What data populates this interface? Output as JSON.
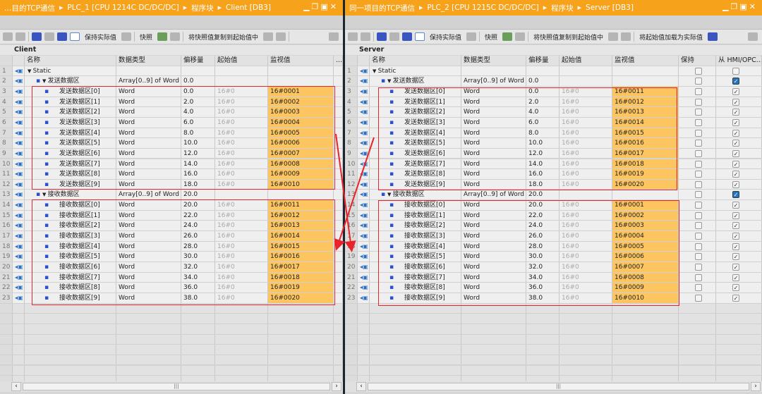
{
  "left": {
    "title": [
      "…目的TCP通信",
      "PLC_1 [CPU 1214C DC/DC/DC]",
      "程序块",
      "Client [DB3]"
    ],
    "toolbar": {
      "keep_actual": "保持实际值",
      "snapshot": "快照",
      "copy_snapshot": "将快照值复制到起始值中"
    },
    "section": "Client",
    "headers": [
      "名称",
      "数据类型",
      "偏移量",
      "起始值",
      "监视值",
      "..."
    ],
    "rows": [
      {
        "n": "1",
        "name": "Static",
        "type": "",
        "off": "",
        "start": "",
        "mon": "",
        "lvl": 0,
        "arrow": true
      },
      {
        "n": "2",
        "name": "发送数据区",
        "type": "Array[0..9] of Word",
        "off": "0.0",
        "start": "",
        "mon": "",
        "lvl": 1,
        "arrow": true
      },
      {
        "n": "3",
        "name": "发送数据区[0]",
        "type": "Word",
        "off": "0.0",
        "start": "16#0",
        "mon": "16#0001",
        "lvl": 2
      },
      {
        "n": "4",
        "name": "发送数据区[1]",
        "type": "Word",
        "off": "2.0",
        "start": "16#0",
        "mon": "16#0002",
        "lvl": 2
      },
      {
        "n": "5",
        "name": "发送数据区[2]",
        "type": "Word",
        "off": "4.0",
        "start": "16#0",
        "mon": "16#0003",
        "lvl": 2
      },
      {
        "n": "6",
        "name": "发送数据区[3]",
        "type": "Word",
        "off": "6.0",
        "start": "16#0",
        "mon": "16#0004",
        "lvl": 2
      },
      {
        "n": "7",
        "name": "发送数据区[4]",
        "type": "Word",
        "off": "8.0",
        "start": "16#0",
        "mon": "16#0005",
        "lvl": 2
      },
      {
        "n": "8",
        "name": "发送数据区[5]",
        "type": "Word",
        "off": "10.0",
        "start": "16#0",
        "mon": "16#0006",
        "lvl": 2
      },
      {
        "n": "9",
        "name": "发送数据区[6]",
        "type": "Word",
        "off": "12.0",
        "start": "16#0",
        "mon": "16#0007",
        "lvl": 2
      },
      {
        "n": "10",
        "name": "发送数据区[7]",
        "type": "Word",
        "off": "14.0",
        "start": "16#0",
        "mon": "16#0008",
        "lvl": 2
      },
      {
        "n": "11",
        "name": "发送数据区[8]",
        "type": "Word",
        "off": "16.0",
        "start": "16#0",
        "mon": "16#0009",
        "lvl": 2
      },
      {
        "n": "12",
        "name": "发送数据区[9]",
        "type": "Word",
        "off": "18.0",
        "start": "16#0",
        "mon": "16#0010",
        "lvl": 2
      },
      {
        "n": "13",
        "name": "接收数据区",
        "type": "Array[0..9] of Word",
        "off": "20.0",
        "start": "",
        "mon": "",
        "lvl": 1,
        "arrow": true
      },
      {
        "n": "14",
        "name": "接收数据区[0]",
        "type": "Word",
        "off": "20.0",
        "start": "16#0",
        "mon": "16#0011",
        "lvl": 2
      },
      {
        "n": "15",
        "name": "接收数据区[1]",
        "type": "Word",
        "off": "22.0",
        "start": "16#0",
        "mon": "16#0012",
        "lvl": 2
      },
      {
        "n": "16",
        "name": "接收数据区[2]",
        "type": "Word",
        "off": "24.0",
        "start": "16#0",
        "mon": "16#0013",
        "lvl": 2
      },
      {
        "n": "17",
        "name": "接收数据区[3]",
        "type": "Word",
        "off": "26.0",
        "start": "16#0",
        "mon": "16#0014",
        "lvl": 2
      },
      {
        "n": "18",
        "name": "接收数据区[4]",
        "type": "Word",
        "off": "28.0",
        "start": "16#0",
        "mon": "16#0015",
        "lvl": 2
      },
      {
        "n": "19",
        "name": "接收数据区[5]",
        "type": "Word",
        "off": "30.0",
        "start": "16#0",
        "mon": "16#0016",
        "lvl": 2
      },
      {
        "n": "20",
        "name": "接收数据区[6]",
        "type": "Word",
        "off": "32.0",
        "start": "16#0",
        "mon": "16#0017",
        "lvl": 2
      },
      {
        "n": "21",
        "name": "接收数据区[7]",
        "type": "Word",
        "off": "34.0",
        "start": "16#0",
        "mon": "16#0018",
        "lvl": 2
      },
      {
        "n": "22",
        "name": "接收数据区[8]",
        "type": "Word",
        "off": "36.0",
        "start": "16#0",
        "mon": "16#0019",
        "lvl": 2
      },
      {
        "n": "23",
        "name": "接收数据区[9]",
        "type": "Word",
        "off": "38.0",
        "start": "16#0",
        "mon": "16#0020",
        "lvl": 2
      }
    ]
  },
  "right": {
    "title": [
      "同一项目的TCP通信",
      "PLC_2 [CPU 1215C DC/DC/DC]",
      "程序块",
      "Server [DB3]"
    ],
    "toolbar": {
      "keep_actual": "保持实际值",
      "snapshot": "快照",
      "copy_snapshot": "将快照值复制到起始值中",
      "load_start": "将起始值加载为实际值"
    },
    "section": "Server",
    "headers": [
      "名称",
      "数据类型",
      "偏移量",
      "起始值",
      "监视值",
      "保持",
      "从 HMI/OPC..."
    ],
    "rows": [
      {
        "n": "1",
        "name": "Static",
        "type": "",
        "off": "",
        "start": "",
        "mon": "",
        "lvl": 0,
        "arrow": true,
        "retain": false,
        "hmi": false
      },
      {
        "n": "2",
        "name": "发送数据区",
        "type": "Array[0..9] of Word",
        "off": "0.0",
        "start": "",
        "mon": "",
        "lvl": 1,
        "arrow": true,
        "retain": false,
        "hmi": true
      },
      {
        "n": "3",
        "name": "发送数据区[0]",
        "type": "Word",
        "off": "0.0",
        "start": "16#0",
        "mon": "16#0011",
        "lvl": 2,
        "retain": false,
        "hmi": true
      },
      {
        "n": "4",
        "name": "发送数据区[1]",
        "type": "Word",
        "off": "2.0",
        "start": "16#0",
        "mon": "16#0012",
        "lvl": 2,
        "retain": false,
        "hmi": true
      },
      {
        "n": "5",
        "name": "发送数据区[2]",
        "type": "Word",
        "off": "4.0",
        "start": "16#0",
        "mon": "16#0013",
        "lvl": 2,
        "retain": false,
        "hmi": true
      },
      {
        "n": "6",
        "name": "发送数据区[3]",
        "type": "Word",
        "off": "6.0",
        "start": "16#0",
        "mon": "16#0014",
        "lvl": 2,
        "retain": false,
        "hmi": true
      },
      {
        "n": "7",
        "name": "发送数据区[4]",
        "type": "Word",
        "off": "8.0",
        "start": "16#0",
        "mon": "16#0015",
        "lvl": 2,
        "retain": false,
        "hmi": true
      },
      {
        "n": "8",
        "name": "发送数据区[5]",
        "type": "Word",
        "off": "10.0",
        "start": "16#0",
        "mon": "16#0016",
        "lvl": 2,
        "retain": false,
        "hmi": true
      },
      {
        "n": "9",
        "name": "发送数据区[6]",
        "type": "Word",
        "off": "12.0",
        "start": "16#0",
        "mon": "16#0017",
        "lvl": 2,
        "retain": false,
        "hmi": true
      },
      {
        "n": "10",
        "name": "发送数据区[7]",
        "type": "Word",
        "off": "14.0",
        "start": "16#0",
        "mon": "16#0018",
        "lvl": 2,
        "retain": false,
        "hmi": true
      },
      {
        "n": "11",
        "name": "发送数据区[8]",
        "type": "Word",
        "off": "16.0",
        "start": "16#0",
        "mon": "16#0019",
        "lvl": 2,
        "retain": false,
        "hmi": true
      },
      {
        "n": "12",
        "name": "发送数据区[9]",
        "type": "Word",
        "off": "18.0",
        "start": "16#0",
        "mon": "16#0020",
        "lvl": 2,
        "retain": false,
        "hmi": true
      },
      {
        "n": "13",
        "name": "接收数据区",
        "type": "Array[0..9] of Word",
        "off": "20.0",
        "start": "",
        "mon": "",
        "lvl": 1,
        "arrow": true,
        "retain": false,
        "hmi": true
      },
      {
        "n": "14",
        "name": "接收数据区[0]",
        "type": "Word",
        "off": "20.0",
        "start": "16#0",
        "mon": "16#0001",
        "lvl": 2,
        "retain": false,
        "hmi": true
      },
      {
        "n": "15",
        "name": "接收数据区[1]",
        "type": "Word",
        "off": "22.0",
        "start": "16#0",
        "mon": "16#0002",
        "lvl": 2,
        "retain": false,
        "hmi": true
      },
      {
        "n": "16",
        "name": "接收数据区[2]",
        "type": "Word",
        "off": "24.0",
        "start": "16#0",
        "mon": "16#0003",
        "lvl": 2,
        "retain": false,
        "hmi": true
      },
      {
        "n": "17",
        "name": "接收数据区[3]",
        "type": "Word",
        "off": "26.0",
        "start": "16#0",
        "mon": "16#0004",
        "lvl": 2,
        "retain": false,
        "hmi": true
      },
      {
        "n": "18",
        "name": "接收数据区[4]",
        "type": "Word",
        "off": "28.0",
        "start": "16#0",
        "mon": "16#0005",
        "lvl": 2,
        "retain": false,
        "hmi": true
      },
      {
        "n": "19",
        "name": "接收数据区[5]",
        "type": "Word",
        "off": "30.0",
        "start": "16#0",
        "mon": "16#0006",
        "lvl": 2,
        "retain": false,
        "hmi": true
      },
      {
        "n": "20",
        "name": "接收数据区[6]",
        "type": "Word",
        "off": "32.0",
        "start": "16#0",
        "mon": "16#0007",
        "lvl": 2,
        "retain": false,
        "hmi": true
      },
      {
        "n": "21",
        "name": "接收数据区[7]",
        "type": "Word",
        "off": "34.0",
        "start": "16#0",
        "mon": "16#0008",
        "lvl": 2,
        "retain": false,
        "hmi": true
      },
      {
        "n": "22",
        "name": "接收数据区[8]",
        "type": "Word",
        "off": "36.0",
        "start": "16#0",
        "mon": "16#0009",
        "lvl": 2,
        "retain": false,
        "hmi": true
      },
      {
        "n": "23",
        "name": "接收数据区[9]",
        "type": "Word",
        "off": "38.0",
        "start": "16#0",
        "mon": "16#0010",
        "lvl": 2,
        "retain": false,
        "hmi": true
      }
    ]
  },
  "colors": {
    "title_bar": "#f7a21b",
    "monitor_cell": "#fcc560",
    "highlight_box": "#e8242a"
  }
}
